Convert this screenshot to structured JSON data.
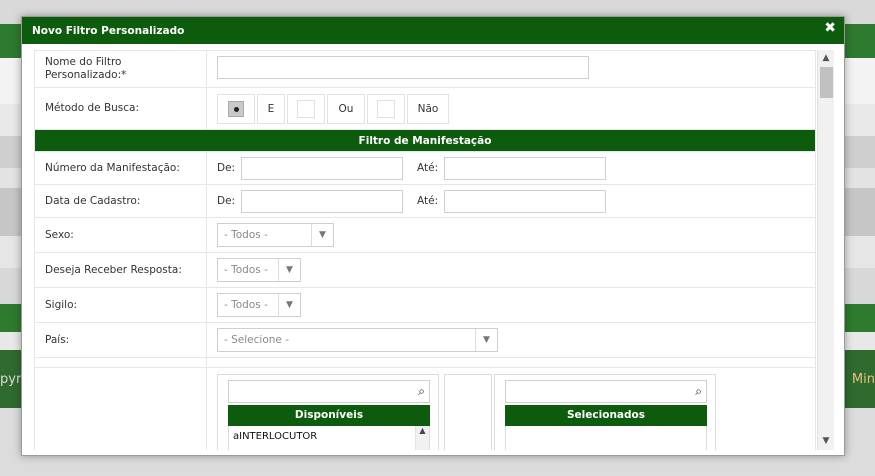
{
  "background": {
    "left_text": "pyr",
    "right_text": "Min"
  },
  "dialog": {
    "title": "Novo Filtro Personalizado",
    "close_glyph": "✖"
  },
  "form": {
    "nome_label": "Nome do Filtro Personalizado:*",
    "nome_value": "",
    "metodo_label": "Método de Busca:",
    "metodo_options": [
      "E",
      "Ou",
      "Não"
    ],
    "section_title": "Filtro de Manifestação",
    "numero_label": "Número da Manifestação:",
    "data_label": "Data de Cadastro:",
    "de_label": "De:",
    "ate_label": "Até:",
    "sexo_label": "Sexo:",
    "sexo_value": "- Todos -",
    "resposta_label": "Deseja Receber Resposta:",
    "resposta_value": "- Todos -",
    "sigilo_label": "Sigilo:",
    "sigilo_value": "- Todos -",
    "pais_label": "País:",
    "pais_value": "- Selecione -"
  },
  "lists": {
    "disponiveis_title": "Disponíveis",
    "selecionados_title": "Selecionados",
    "disponiveis_items": [
      "aINTERLOCUTOR"
    ]
  },
  "colors": {
    "brand_green": "#0d5c0d"
  },
  "icons": {
    "search": "⌕",
    "dropdown": "▼",
    "scroll_up": "▲",
    "scroll_down": "▼"
  }
}
